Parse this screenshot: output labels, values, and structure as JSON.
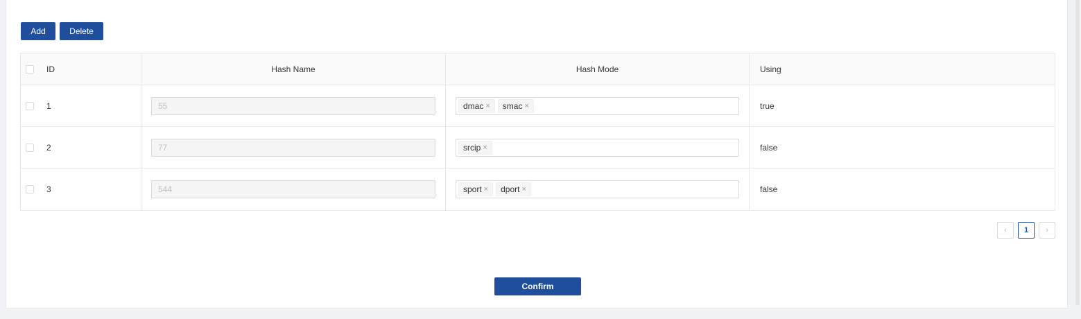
{
  "toolbar": {
    "add_label": "Add",
    "delete_label": "Delete"
  },
  "table": {
    "headers": {
      "id": "ID",
      "hash_name": "Hash Name",
      "hash_mode": "Hash Mode",
      "using": "Using"
    },
    "rows": [
      {
        "id": "1",
        "hash_name": "55",
        "modes": [
          "dmac",
          "smac"
        ],
        "using": "true"
      },
      {
        "id": "2",
        "hash_name": "77",
        "modes": [
          "srcip"
        ],
        "using": "false"
      },
      {
        "id": "3",
        "hash_name": "544",
        "modes": [
          "sport",
          "dport"
        ],
        "using": "false"
      }
    ]
  },
  "pagination": {
    "prev_icon": "‹",
    "current_page": "1",
    "next_icon": "›"
  },
  "footer": {
    "confirm_label": "Confirm"
  },
  "icons": {
    "tag_remove": "×"
  },
  "colors": {
    "primary": "#1f4e9c"
  }
}
